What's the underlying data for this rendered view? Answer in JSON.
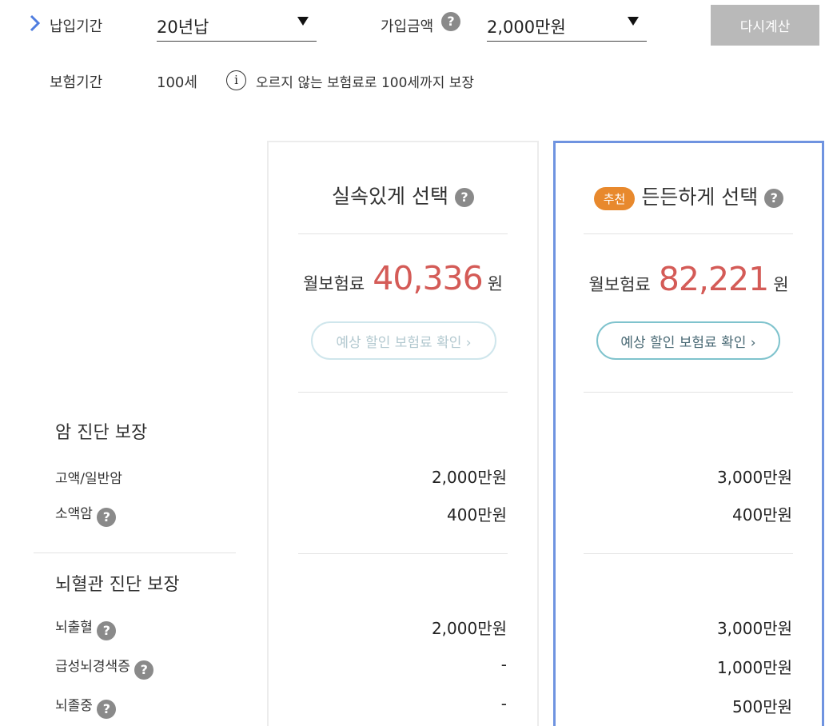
{
  "settings": {
    "payment_period_label": "납입기간",
    "payment_period_value": "20년납",
    "coverage_amount_label": "가입금액",
    "coverage_amount_value": "2,000만원",
    "recalc_label": "다시계산",
    "insurance_period_label": "보험기간",
    "insurance_period_value": "100세",
    "insurance_period_note": "오르지 않는 보험료로 100세까지 보장"
  },
  "plans": [
    {
      "title": "실속있게 선택",
      "badge": "",
      "premium_label": "월보험료",
      "premium_amount": "40,336",
      "premium_unit": "원",
      "discount_label": "예상 할인 보험료 확인 ›"
    },
    {
      "title": "든든하게 선택",
      "badge": "추천",
      "premium_label": "월보험료",
      "premium_amount": "82,221",
      "premium_unit": "원",
      "discount_label": "예상 할인 보험료 확인 ›"
    }
  ],
  "sections": [
    {
      "title": "암 진단 보장",
      "items": [
        {
          "name": "고액/일반암",
          "help": false,
          "plan1": "2,000만원",
          "plan2": "3,000만원"
        },
        {
          "name": "소액암",
          "help": true,
          "plan1": "400만원",
          "plan2": "400만원"
        }
      ]
    },
    {
      "title": "뇌혈관 진단 보장",
      "items": [
        {
          "name": "뇌출혈",
          "help": true,
          "plan1": "2,000만원",
          "plan2": "3,000만원"
        },
        {
          "name": "급성뇌경색증",
          "help": true,
          "plan1": "-",
          "plan2": "1,000만원"
        },
        {
          "name": "뇌졸중",
          "help": true,
          "plan1": "-",
          "plan2": "500만원"
        }
      ]
    }
  ],
  "colors": {
    "accent_blue": "#6f93e0",
    "premium_red": "#d45b57",
    "badge_orange": "#e8892d",
    "recalc_gray": "#b9b9b9"
  }
}
